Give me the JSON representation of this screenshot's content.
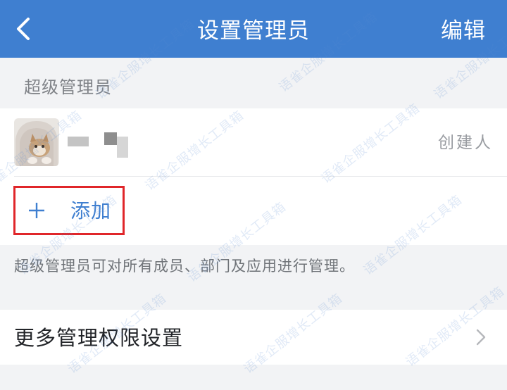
{
  "navbar": {
    "title": "设置管理员",
    "edit_label": "编辑",
    "back_icon": "chevron-left-icon"
  },
  "super_admin": {
    "section_title": "超级管理员",
    "members": [
      {
        "role": "创建人"
      }
    ],
    "add_icon": "plus-icon",
    "add_label": "添加",
    "description": "超级管理员可对所有成员、部门及应用进行管理。"
  },
  "more": {
    "label": "更多管理权限设置",
    "icon": "chevron-right-icon"
  },
  "watermark": {
    "text": "语雀企服增长工具箱"
  },
  "colors": {
    "accent": "#3f7fd0",
    "highlight_border": "#e0262a",
    "background": "#f2f3f5"
  }
}
